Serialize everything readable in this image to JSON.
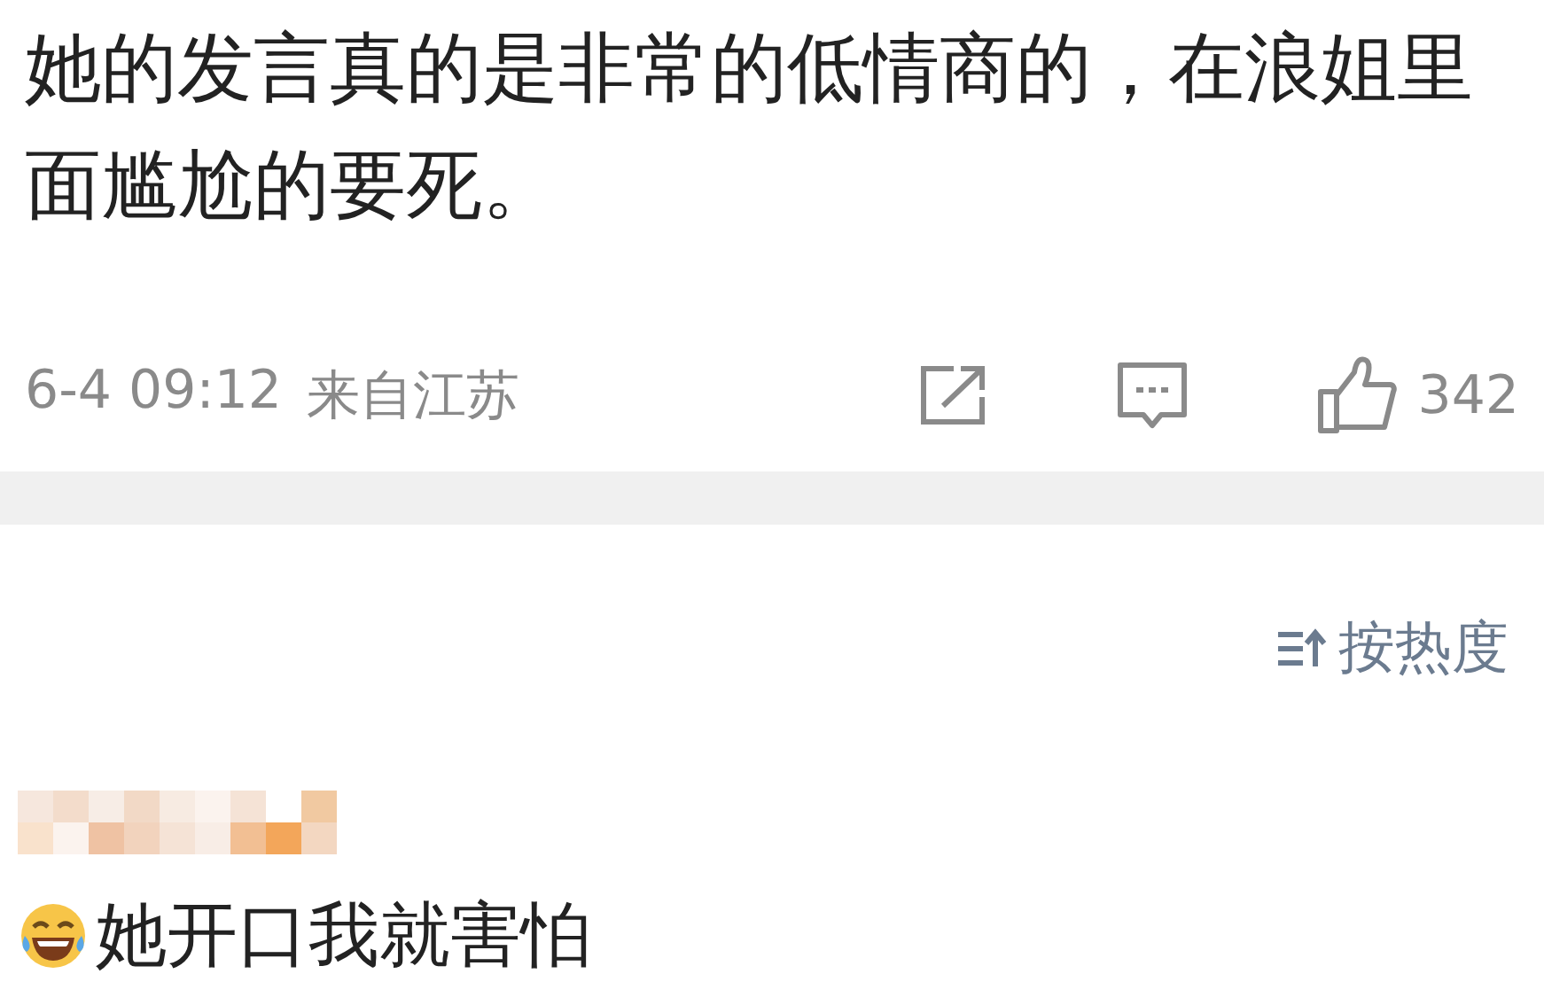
{
  "post": {
    "text": "她的发言真的是非常的低情商的，在浪姐里面尴尬的要死。",
    "time": "6-4 09:12",
    "source": "来自江苏",
    "like_count": "342"
  },
  "comments": {
    "sort_label": "按热度",
    "items": [
      {
        "text": "她开口我就害怕"
      }
    ]
  }
}
